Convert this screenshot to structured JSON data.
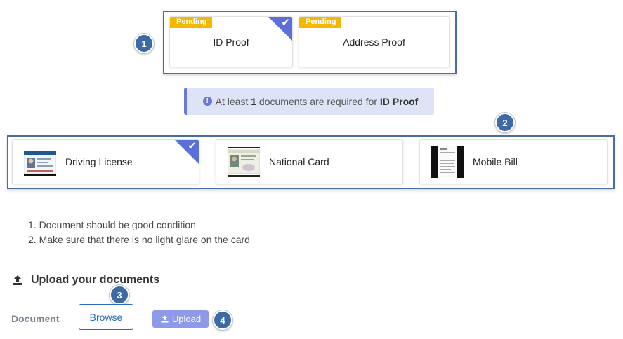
{
  "steps": [
    "1",
    "2",
    "3",
    "4"
  ],
  "proofs": [
    {
      "status": "Pending",
      "label": "ID Proof",
      "selected": true
    },
    {
      "status": "Pending",
      "label": "Address Proof",
      "selected": false
    }
  ],
  "alert": {
    "prefix": "At least",
    "count": "1",
    "middle": "documents are required for",
    "target": "ID Proof"
  },
  "documents": [
    {
      "label": "Driving License",
      "icon": "driving-license-thumbnail",
      "selected": true
    },
    {
      "label": "National Card",
      "icon": "national-card-thumbnail",
      "selected": false
    },
    {
      "label": "Mobile Bill",
      "icon": "mobile-bill-thumbnail",
      "selected": false
    }
  ],
  "instructions": [
    "1. Document should be good condition",
    "2. Make sure that there is no light glare on the card"
  ],
  "upload": {
    "title": "Upload your documents",
    "field_label": "Document",
    "browse_label": "Browse",
    "upload_label": "Upload"
  },
  "colors": {
    "pending": "#f5b800",
    "accent": "#5b6fd6",
    "highlight_border": "#4a6f9e",
    "badge": "#3d6aa3",
    "browse": "#2a6cb6",
    "upload_btn": "#8e99e8",
    "alert_bg": "#dfe3f7"
  }
}
